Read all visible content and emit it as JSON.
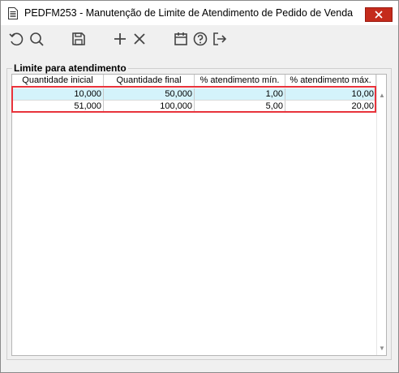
{
  "window": {
    "title": "PEDFM253 - Manutenção de Limite de Atendimento de Pedido de Venda"
  },
  "toolbar": {
    "buttons": [
      {
        "name": "refresh-button",
        "icon": "undo-icon"
      },
      {
        "name": "search-button",
        "icon": "search-icon"
      },
      {
        "name": "save-button",
        "icon": "save-icon"
      },
      {
        "name": "add-button",
        "icon": "plus-icon"
      },
      {
        "name": "delete-button",
        "icon": "x-icon"
      },
      {
        "name": "calendar-button",
        "icon": "calendar-icon"
      },
      {
        "name": "help-button",
        "icon": "help-icon"
      },
      {
        "name": "exit-button",
        "icon": "exit-icon"
      }
    ]
  },
  "group": {
    "label": "Limite para atendimento"
  },
  "table": {
    "columns": [
      "Quantidade inicial",
      "Quantidade final",
      "% atendimento mín.",
      "% atendimento máx."
    ],
    "rows": [
      [
        "10,000",
        "50,000",
        "1,00",
        "10,00"
      ],
      [
        "51,000",
        "100,000",
        "5,00",
        "20,00"
      ]
    ],
    "selected_row": 0
  },
  "colors": {
    "selection": "#d4f3fb",
    "highlight_border": "#e8333b",
    "close_button": "#c42b1c"
  }
}
